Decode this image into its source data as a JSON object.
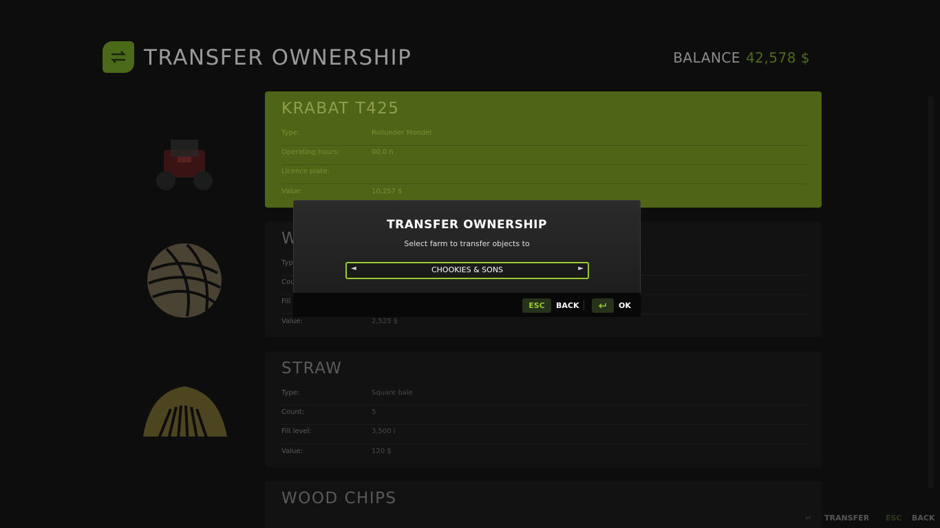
{
  "header": {
    "title": "TRANSFER OWNERSHIP",
    "balance_label": "BALANCE",
    "balance_value": "42,578 $"
  },
  "items": [
    {
      "title": "KRABAT T425",
      "rows": [
        {
          "k": "Type:",
          "v": "Rollunder Mondel"
        },
        {
          "k": "Operating hours:",
          "v": "00.0 h"
        },
        {
          "k": "Licence plate:",
          "v": ""
        },
        {
          "k": "Value:",
          "v": "10,257 $"
        }
      ]
    },
    {
      "title": "W",
      "rows": [
        {
          "k": "Typ",
          "v": ""
        },
        {
          "k": "Cou",
          "v": ""
        },
        {
          "k": "Fill",
          "v": ""
        },
        {
          "k": "Value:",
          "v": "2,525 $"
        }
      ]
    },
    {
      "title": "STRAW",
      "rows": [
        {
          "k": "Type:",
          "v": "Square bale"
        },
        {
          "k": "Count:",
          "v": "5"
        },
        {
          "k": "Fill level:",
          "v": "3,500 l"
        },
        {
          "k": "Value:",
          "v": "120 $"
        }
      ]
    },
    {
      "title": "WOOD CHIPS"
    }
  ],
  "modal": {
    "title": "TRANSFER OWNERSHIP",
    "subtitle": "Select farm to transfer objects to",
    "selector_value": "CHOOKIES & SONS",
    "esc_key": "ESC",
    "back_label": "BACK",
    "ok_label": "OK"
  },
  "footer": {
    "transfer_label": "TRANSFER",
    "esc_key": "ESC",
    "back_label": "BACK"
  },
  "colors": {
    "accent": "#9acb31",
    "selected_panel": "#4e6518"
  }
}
